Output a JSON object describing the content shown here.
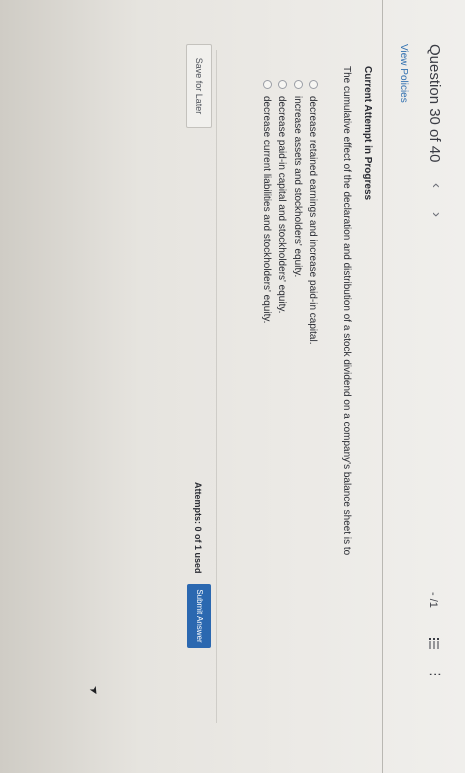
{
  "header": {
    "question_label": "Question 30 of 40",
    "prev_glyph": "‹",
    "next_glyph": "›",
    "score": "- /1",
    "more_glyph": "⋮",
    "view_policies": "View Policies"
  },
  "attempt": {
    "heading": "Current Attempt in Progress"
  },
  "question": {
    "text": "The cumulative effect of the declaration and distribution of a stock dividend on a company's balance sheet is to",
    "options": [
      "decrease retained earnings and increase paid-in capital.",
      "increase assets and stockholders' equity.",
      "decrease paid-in capital and stockholders' equity.",
      "decrease current liabilities and stockholders' equity."
    ]
  },
  "footer": {
    "save_for_later": "Save for Later",
    "attempts": "Attempts: 0 of 1 used",
    "submit": "Submit Answer"
  },
  "colors": {
    "accent": "#2b68b0",
    "link": "#2f6fb0",
    "background": "#ebe9e5"
  },
  "icons": [
    "chevron-left-icon",
    "chevron-right-icon",
    "list-icon",
    "more-vertical-icon",
    "radio-icon",
    "cursor-icon"
  ]
}
